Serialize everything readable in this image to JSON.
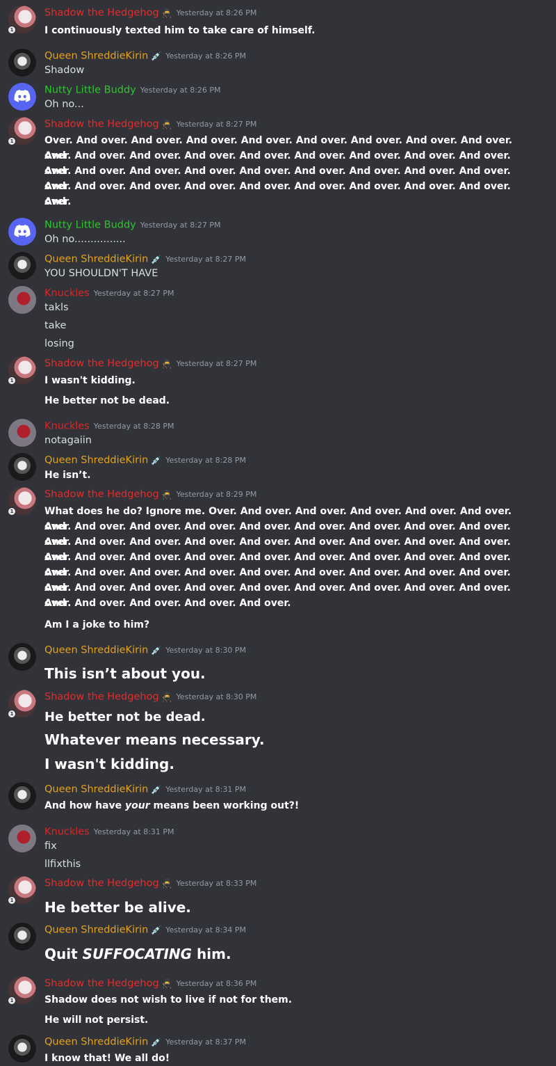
{
  "users": {
    "shadow": {
      "name": "Shadow the Hedgehog",
      "color": "#e02d2d",
      "role_icon": "ninja-icon"
    },
    "queen": {
      "name": "Queen ShreddieKirin",
      "color": "#e5a21a",
      "role_icon": "syringe-icon"
    },
    "buddy": {
      "name": "Nutty Little Buddy",
      "color": "#2ec52e",
      "avatar_icon": "discord-logo-icon"
    },
    "knuckles": {
      "name": "Knuckles",
      "color": "#dc2525"
    }
  },
  "messages": [
    {
      "author": "Shadow the Hedgehog",
      "time": "Yesterday at 8:26 PM",
      "lines": [
        "I continuously texted him to take care of himself."
      ]
    },
    {
      "author": "Queen ShreddieKirin",
      "time": "Yesterday at 8:26 PM",
      "lines": [
        "Shadow"
      ]
    },
    {
      "author": "Nutty Little Buddy",
      "time": "Yesterday at 8:26 PM",
      "lines": [
        "Oh no..."
      ]
    },
    {
      "author": "Shadow the Hedgehog",
      "time": "Yesterday at 8:27 PM",
      "lines": [
        "Over. And over. And over. And over. And over. And over. And over. And over. And over. And",
        "over. And over. And over. And over. And over. And over. And over. And over. And over. And",
        "over. And over. And over. And over. And over. And over. And over. And over. And over. And",
        "over. And over. And over. And over. And over. And over. And over. And over. And over. And",
        "over."
      ]
    },
    {
      "author": "Nutty Little Buddy",
      "time": "Yesterday at 8:27 PM",
      "lines": [
        "Oh no................"
      ]
    },
    {
      "author": "Queen ShreddieKirin",
      "time": "Yesterday at 8:27 PM",
      "lines": [
        "YOU SHOULDN'T HAVE"
      ]
    },
    {
      "author": "Knuckles",
      "time": "Yesterday at 8:27 PM",
      "lines": [
        "takls",
        "take",
        "losing"
      ]
    },
    {
      "author": "Shadow the Hedgehog",
      "time": "Yesterday at 8:27 PM",
      "lines": [
        "I wasn't kidding.",
        "He better not be dead."
      ]
    },
    {
      "author": "Knuckles",
      "time": "Yesterday at 8:28 PM",
      "lines": [
        "notagaiin"
      ]
    },
    {
      "author": "Queen ShreddieKirin",
      "time": "Yesterday at 8:28 PM",
      "lines": [
        "He isn’t."
      ]
    },
    {
      "author": "Shadow the Hedgehog",
      "time": "Yesterday at 8:29 PM",
      "lines": [
        "What does he do? Ignore me. Over. And over. And over. And over. And over. And over. And",
        "over. And over. And over. And over. And over. And over. And over. And over. And over. And",
        "over. And over. And over. And over. And over. And over. And over. And over. And over. And",
        "over. And over. And over. And over. And over. And over. And over. And over. And over. And",
        "over. And over. And over. And over. And over. And over. And over. And over. And over. And",
        "over. And over. And over. And over. And over. And over. And over. And over. And over. And",
        "over. And over. And over. And over. And over.",
        "Am I a joke to him?"
      ]
    },
    {
      "author": "Queen ShreddieKirin",
      "time": "Yesterday at 8:30 PM",
      "lines": [
        "This isn’t about you."
      ]
    },
    {
      "author": "Shadow the Hedgehog",
      "time": "Yesterday at 8:30 PM",
      "lines": [
        "He better not be dead.",
        "Whatever means necessary.",
        "I wasn't kidding."
      ]
    },
    {
      "author": "Queen ShreddieKirin",
      "time": "Yesterday at 8:31 PM",
      "lines": [
        "And how have ",
        "your",
        " means been working out?!"
      ]
    },
    {
      "author": "Knuckles",
      "time": "Yesterday at 8:31 PM",
      "lines": [
        "fix",
        "llfixthis"
      ]
    },
    {
      "author": "Shadow the Hedgehog",
      "time": "Yesterday at 8:33 PM",
      "lines": [
        "He better be alive."
      ]
    },
    {
      "author": "Queen ShreddieKirin",
      "time": "Yesterday at 8:34 PM",
      "lines": [
        "Quit ",
        "SUFFOCATING",
        " him."
      ]
    },
    {
      "author": "Shadow the Hedgehog",
      "time": "Yesterday at 8:36 PM",
      "lines": [
        "Shadow does not wish to live if not for them.",
        "He will not persist."
      ]
    },
    {
      "author": "Queen ShreddieKirin",
      "time": "Yesterday at 8:37 PM",
      "lines": [
        "I know that! We all do!"
      ]
    }
  ]
}
